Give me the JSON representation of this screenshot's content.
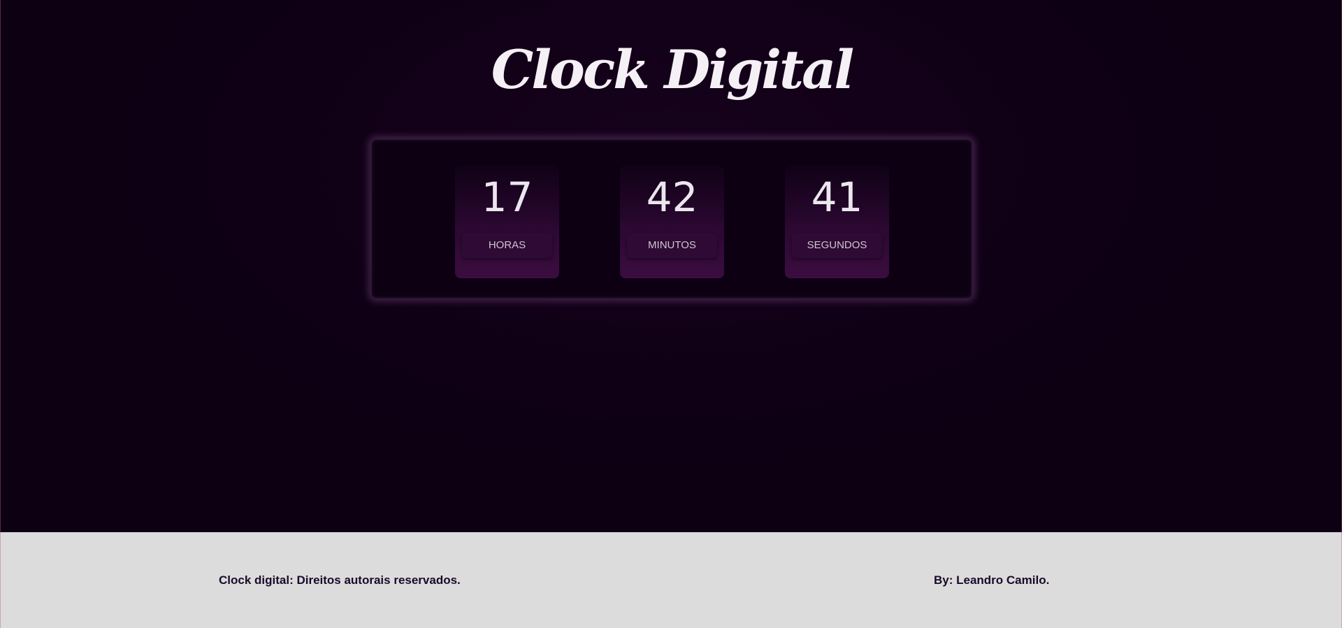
{
  "page": {
    "title": "Clock Digital"
  },
  "clock": {
    "hours": {
      "value": "17",
      "label": "HORAS"
    },
    "minutes": {
      "value": "42",
      "label": "MINUTOS"
    },
    "seconds": {
      "value": "41",
      "label": "SEGUNDOS"
    }
  },
  "footer": {
    "copyright": "Clock digital: Direitos autorais reservados.",
    "author": "By: Leandro Camilo."
  },
  "colors": {
    "background": "#0d0013",
    "panel_glow": "#6e3c78",
    "unit_gradient_end": "#3b0d40",
    "label_bg": "#2e0a34",
    "footer_bg": "#dcdcdc",
    "footer_text": "#1a0a2a"
  }
}
